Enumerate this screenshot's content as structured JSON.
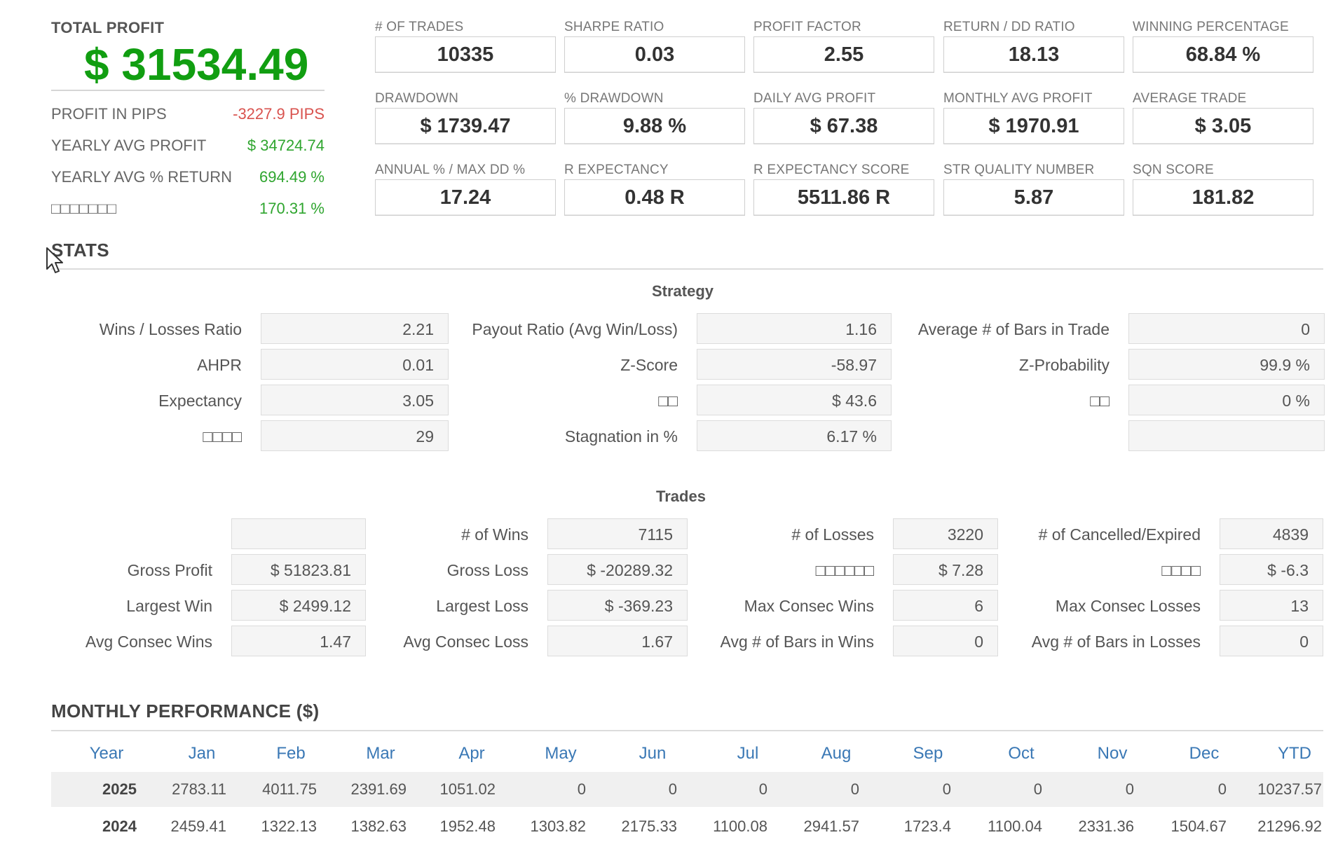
{
  "summary": {
    "total_profit_label": "TOTAL PROFIT",
    "total_profit_value": "$ 31534.49",
    "rows": [
      {
        "label": "PROFIT IN PIPS",
        "value": "-3227.9 PIPS",
        "tone": "neg"
      },
      {
        "label": "YEARLY AVG PROFIT",
        "value": "$ 34724.74",
        "tone": "pos"
      },
      {
        "label": "YEARLY AVG % RETURN",
        "value": "694.49 %",
        "tone": "pos"
      },
      {
        "label": "□□□□□□□",
        "value": "170.31 %",
        "tone": "pos"
      }
    ]
  },
  "kpis": [
    {
      "label": "# OF TRADES",
      "value": "10335"
    },
    {
      "label": "SHARPE RATIO",
      "value": "0.03"
    },
    {
      "label": "PROFIT FACTOR",
      "value": "2.55"
    },
    {
      "label": "RETURN / DD RATIO",
      "value": "18.13"
    },
    {
      "label": "WINNING PERCENTAGE",
      "value": "68.84 %"
    },
    {
      "label": "DRAWDOWN",
      "value": "$ 1739.47"
    },
    {
      "label": "% DRAWDOWN",
      "value": "9.88 %"
    },
    {
      "label": "DAILY AVG PROFIT",
      "value": "$ 67.38"
    },
    {
      "label": "MONTHLY AVG PROFIT",
      "value": "$ 1970.91"
    },
    {
      "label": "AVERAGE TRADE",
      "value": "$ 3.05"
    },
    {
      "label": "ANNUAL % / MAX DD %",
      "value": "17.24"
    },
    {
      "label": "R EXPECTANCY",
      "value": "0.48 R"
    },
    {
      "label": "R EXPECTANCY SCORE",
      "value": "5511.86 R"
    },
    {
      "label": "STR QUALITY NUMBER",
      "value": "5.87"
    },
    {
      "label": "SQN SCORE",
      "value": "181.82"
    }
  ],
  "stats": {
    "title": "STATS",
    "strategy": {
      "title": "Strategy",
      "rows": [
        [
          {
            "label": "Wins / Losses Ratio",
            "value": "2.21"
          },
          {
            "label": "Payout Ratio (Avg Win/Loss)",
            "value": "1.16"
          },
          {
            "label": "Average # of Bars in Trade",
            "value": "0"
          }
        ],
        [
          {
            "label": "AHPR",
            "value": "0.01"
          },
          {
            "label": "Z-Score",
            "value": "-58.97"
          },
          {
            "label": "Z-Probability",
            "value": "99.9 %"
          }
        ],
        [
          {
            "label": "Expectancy",
            "value": "3.05"
          },
          {
            "label": "□□",
            "value": "$ 43.6"
          },
          {
            "label": "□□",
            "value": "0 %"
          }
        ],
        [
          {
            "label": "□□□□",
            "value": "29"
          },
          {
            "label": "Stagnation in %",
            "value": "6.17 %"
          },
          {
            "label": "",
            "value": ""
          }
        ]
      ]
    },
    "trades": {
      "title": "Trades",
      "rows": [
        [
          {
            "label": "",
            "value": ""
          },
          {
            "label": "# of Wins",
            "value": "7115"
          },
          {
            "label": "# of Losses",
            "value": "3220"
          },
          {
            "label": "# of Cancelled/Expired",
            "value": "4839"
          }
        ],
        [
          {
            "label": "Gross Profit",
            "value": "$ 51823.81"
          },
          {
            "label": "Gross Loss",
            "value": "$ -20289.32"
          },
          {
            "label": "□□□□□□",
            "value": "$ 7.28"
          },
          {
            "label": "□□□□",
            "value": "$ -6.3"
          }
        ],
        [
          {
            "label": "Largest Win",
            "value": "$ 2499.12"
          },
          {
            "label": "Largest Loss",
            "value": "$ -369.23"
          },
          {
            "label": "Max Consec Wins",
            "value": "6"
          },
          {
            "label": "Max Consec Losses",
            "value": "13"
          }
        ],
        [
          {
            "label": "Avg Consec Wins",
            "value": "1.47"
          },
          {
            "label": "Avg Consec Loss",
            "value": "1.67"
          },
          {
            "label": "Avg # of Bars in Wins",
            "value": "0"
          },
          {
            "label": "Avg # of Bars in Losses",
            "value": "0"
          }
        ]
      ]
    }
  },
  "monthly": {
    "title": "MONTHLY PERFORMANCE ($)",
    "headers": [
      "Year",
      "Jan",
      "Feb",
      "Mar",
      "Apr",
      "May",
      "Jun",
      "Jul",
      "Aug",
      "Sep",
      "Oct",
      "Nov",
      "Dec",
      "YTD"
    ],
    "rows": [
      [
        "2025",
        "2783.11",
        "4011.75",
        "2391.69",
        "1051.02",
        "0",
        "0",
        "0",
        "0",
        "0",
        "0",
        "0",
        "0",
        "10237.57"
      ],
      [
        "2024",
        "2459.41",
        "1322.13",
        "1382.63",
        "1952.48",
        "1303.82",
        "2175.33",
        "1100.08",
        "2941.57",
        "1723.4",
        "1100.04",
        "2331.36",
        "1504.67",
        "21296.92"
      ]
    ]
  },
  "colors": {
    "profit_green": "#119e11",
    "positive": "#2fa52f",
    "negative": "#d9534f",
    "header_blue": "#3a78b5"
  }
}
